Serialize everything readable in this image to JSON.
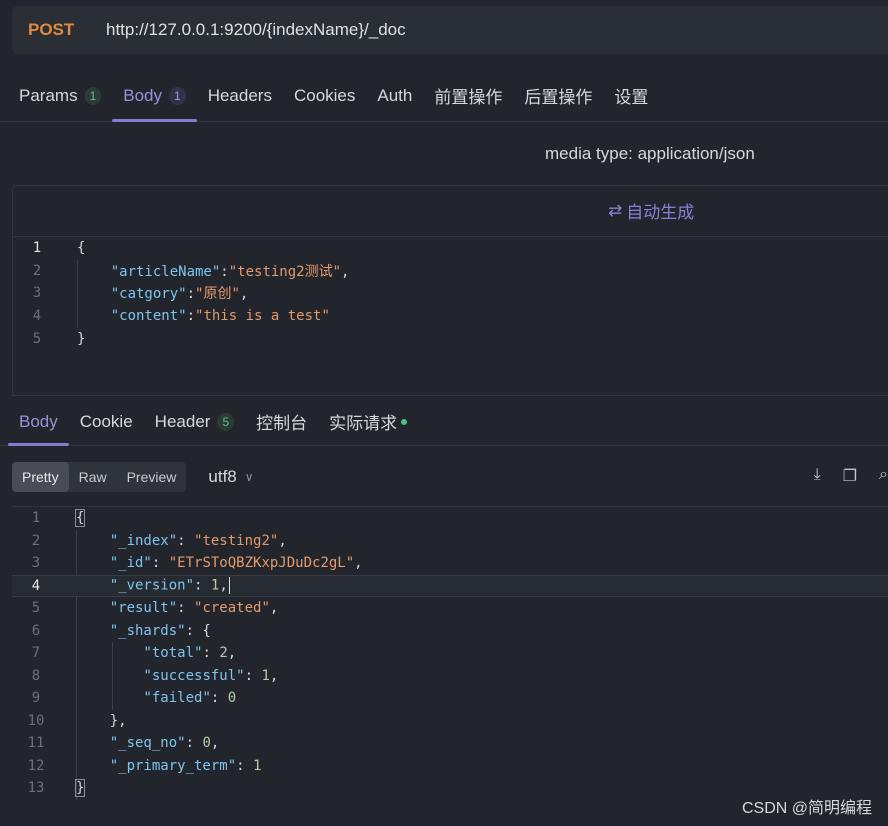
{
  "request": {
    "method": "POST",
    "url": "http://127.0.0.1:9200/{indexName}/_doc"
  },
  "request_tabs": [
    {
      "label": "Params",
      "badge": "1"
    },
    {
      "label": "Body",
      "badge": "1",
      "active": true
    },
    {
      "label": "Headers"
    },
    {
      "label": "Cookies"
    },
    {
      "label": "Auth"
    },
    {
      "label": "前置操作"
    },
    {
      "label": "后置操作"
    },
    {
      "label": "设置"
    }
  ],
  "media_type": "media type: application/json",
  "auto_generate": {
    "icon": "refresh-icon",
    "label": "自动生成"
  },
  "request_body_lines": [
    "1",
    "2",
    "3",
    "4",
    "5"
  ],
  "request_body": {
    "open": "{",
    "f1_key": "\"articleName\"",
    "f1_val": "\"testing2测试\"",
    "f2_key": "\"catgory\"",
    "f2_val": "\"原创\"",
    "f3_key": "\"content\"",
    "f3_val": "\"this is a test\"",
    "close": "}"
  },
  "response_tabs": [
    {
      "label": "Body",
      "active": true
    },
    {
      "label": "Cookie"
    },
    {
      "label": "Header",
      "badge": "5"
    },
    {
      "label": "控制台"
    },
    {
      "label": "实际请求",
      "dot_color": "#4cc07e"
    }
  ],
  "view_modes": {
    "pretty": "Pretty",
    "raw": "Raw",
    "preview": "Preview",
    "selected": "Pretty"
  },
  "encoding": "utf8",
  "toolbar_icons": [
    "download-icon",
    "copy-icon",
    "search-icon"
  ],
  "response_lines": [
    "1",
    "2",
    "3",
    "4",
    "5",
    "6",
    "7",
    "8",
    "9",
    "10",
    "11",
    "12",
    "13"
  ],
  "response_body": {
    "index_key": "\"_index\"",
    "index_val": "\"testing2\"",
    "id_key": "\"_id\"",
    "id_val": "\"ETrSToQBZKxpJDuDc2gL\"",
    "version_key": "\"_version\"",
    "version_val": "1",
    "result_key": "\"result\"",
    "result_val": "\"created\"",
    "shards_key": "\"_shards\"",
    "total_key": "\"total\"",
    "total_val": "2",
    "successful_key": "\"successful\"",
    "successful_val": "1",
    "failed_key": "\"failed\"",
    "failed_val": "0",
    "seq_key": "\"_seq_no\"",
    "seq_val": "0",
    "term_key": "\"_primary_term\"",
    "term_val": "1"
  },
  "watermark": "CSDN @简明编程"
}
